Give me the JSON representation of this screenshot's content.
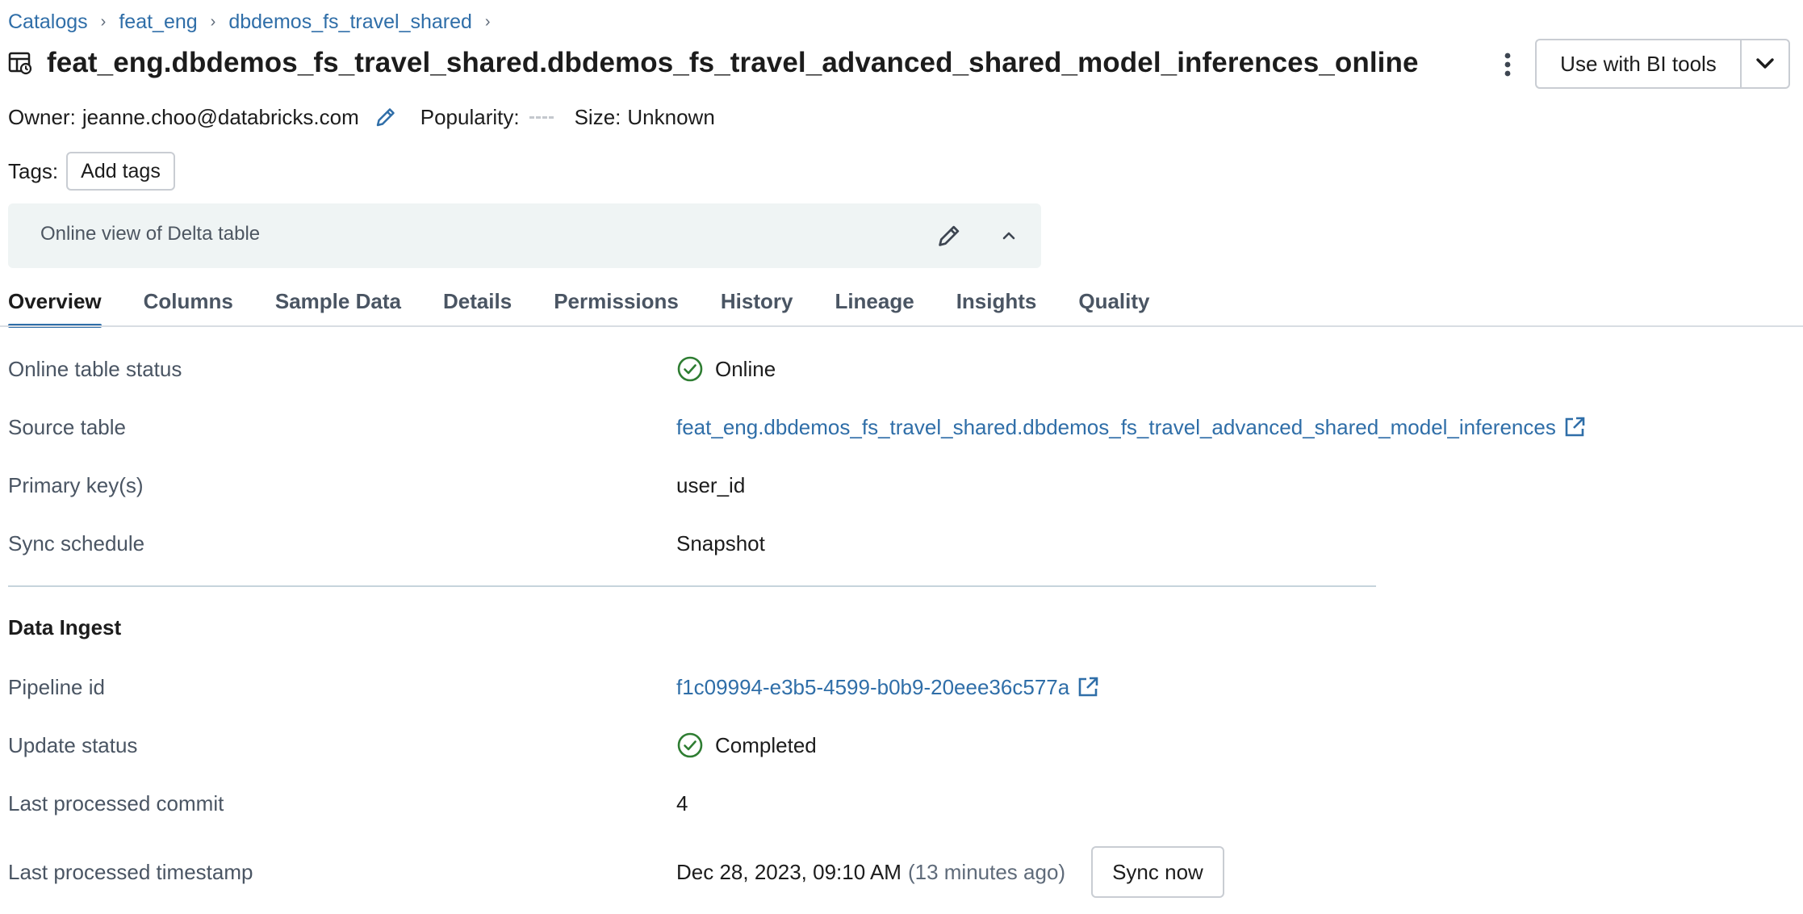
{
  "breadcrumb": [
    "Catalogs",
    "feat_eng",
    "dbdemos_fs_travel_shared"
  ],
  "title": "feat_eng.dbdemos_fs_travel_shared.dbdemos_fs_travel_advanced_shared_model_inferences_online",
  "actions": {
    "bi_tools_label": "Use with BI tools"
  },
  "meta": {
    "owner_label": "Owner:",
    "owner": "jeanne.choo@databricks.com",
    "popularity_label": "Popularity:",
    "size_label": "Size:",
    "size": "Unknown"
  },
  "tags": {
    "label": "Tags:",
    "add_label": "Add tags"
  },
  "description": "Online view of Delta table",
  "tabs": [
    "Overview",
    "Columns",
    "Sample Data",
    "Details",
    "Permissions",
    "History",
    "Lineage",
    "Insights",
    "Quality"
  ],
  "active_tab": "Overview",
  "overview": {
    "status_label": "Online table status",
    "status": "Online",
    "source_label": "Source table",
    "source": "feat_eng.dbdemos_fs_travel_shared.dbdemos_fs_travel_advanced_shared_model_inferences",
    "pk_label": "Primary key(s)",
    "pk": "user_id",
    "schedule_label": "Sync schedule",
    "schedule": "Snapshot"
  },
  "ingest": {
    "title": "Data Ingest",
    "pipeline_label": "Pipeline id",
    "pipeline": "f1c09994-e3b5-4599-b0b9-20eee36c577a",
    "update_label": "Update status",
    "update": "Completed",
    "commit_label": "Last processed commit",
    "commit": "4",
    "ts_label": "Last processed timestamp",
    "ts": "Dec 28, 2023, 09:10 AM",
    "ts_relative": "(13 minutes ago)",
    "sync_label": "Sync now"
  },
  "colors": {
    "link": "#2f6ea8",
    "success": "#2e7d32",
    "accent": "#2f6ea8"
  }
}
